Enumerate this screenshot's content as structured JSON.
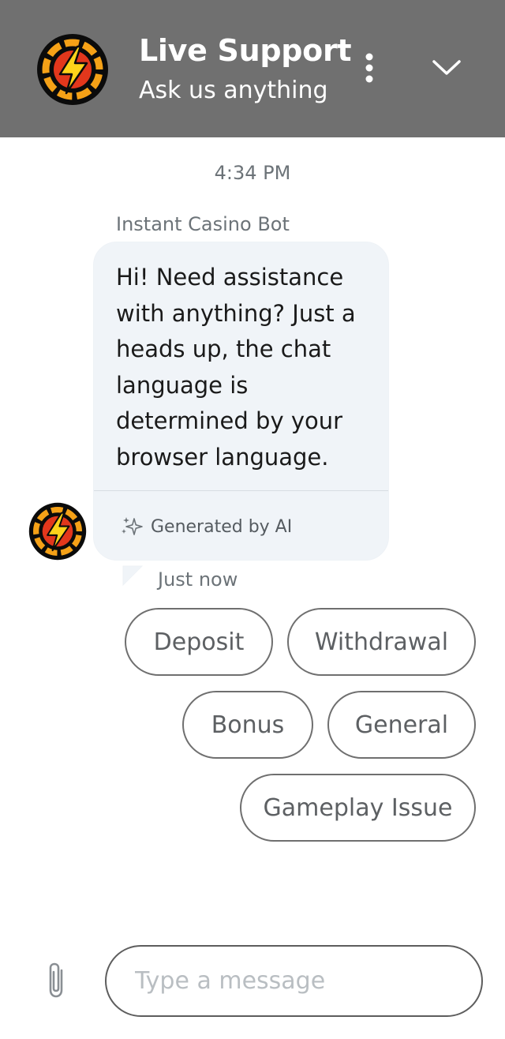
{
  "header": {
    "title": "Live Support",
    "subtitle": "Ask us anything",
    "logo_icon": "lightning-chip-logo",
    "menu_icon": "more-vertical-icon",
    "collapse_icon": "chevron-down-icon",
    "background_color": "#707070"
  },
  "conversation": {
    "timestamp": "4:34 PM",
    "sender_name": "Instant Casino Bot",
    "message_text": "Hi! Need assistance with anything? Just a heads up, the chat language is determined by your browser language.",
    "ai_badge_label": "Generated by AI",
    "ai_badge_icon": "sparkles-icon",
    "message_time": "Just now",
    "bubble_color": "#f0f4f8"
  },
  "quick_replies": {
    "deposit": "Deposit",
    "withdrawal": "Withdrawal",
    "bonus": "Bonus",
    "general": "General",
    "gameplay_issue": "Gameplay Issue"
  },
  "composer": {
    "placeholder": "Type a message",
    "value": "",
    "attach_icon": "paperclip-icon"
  }
}
